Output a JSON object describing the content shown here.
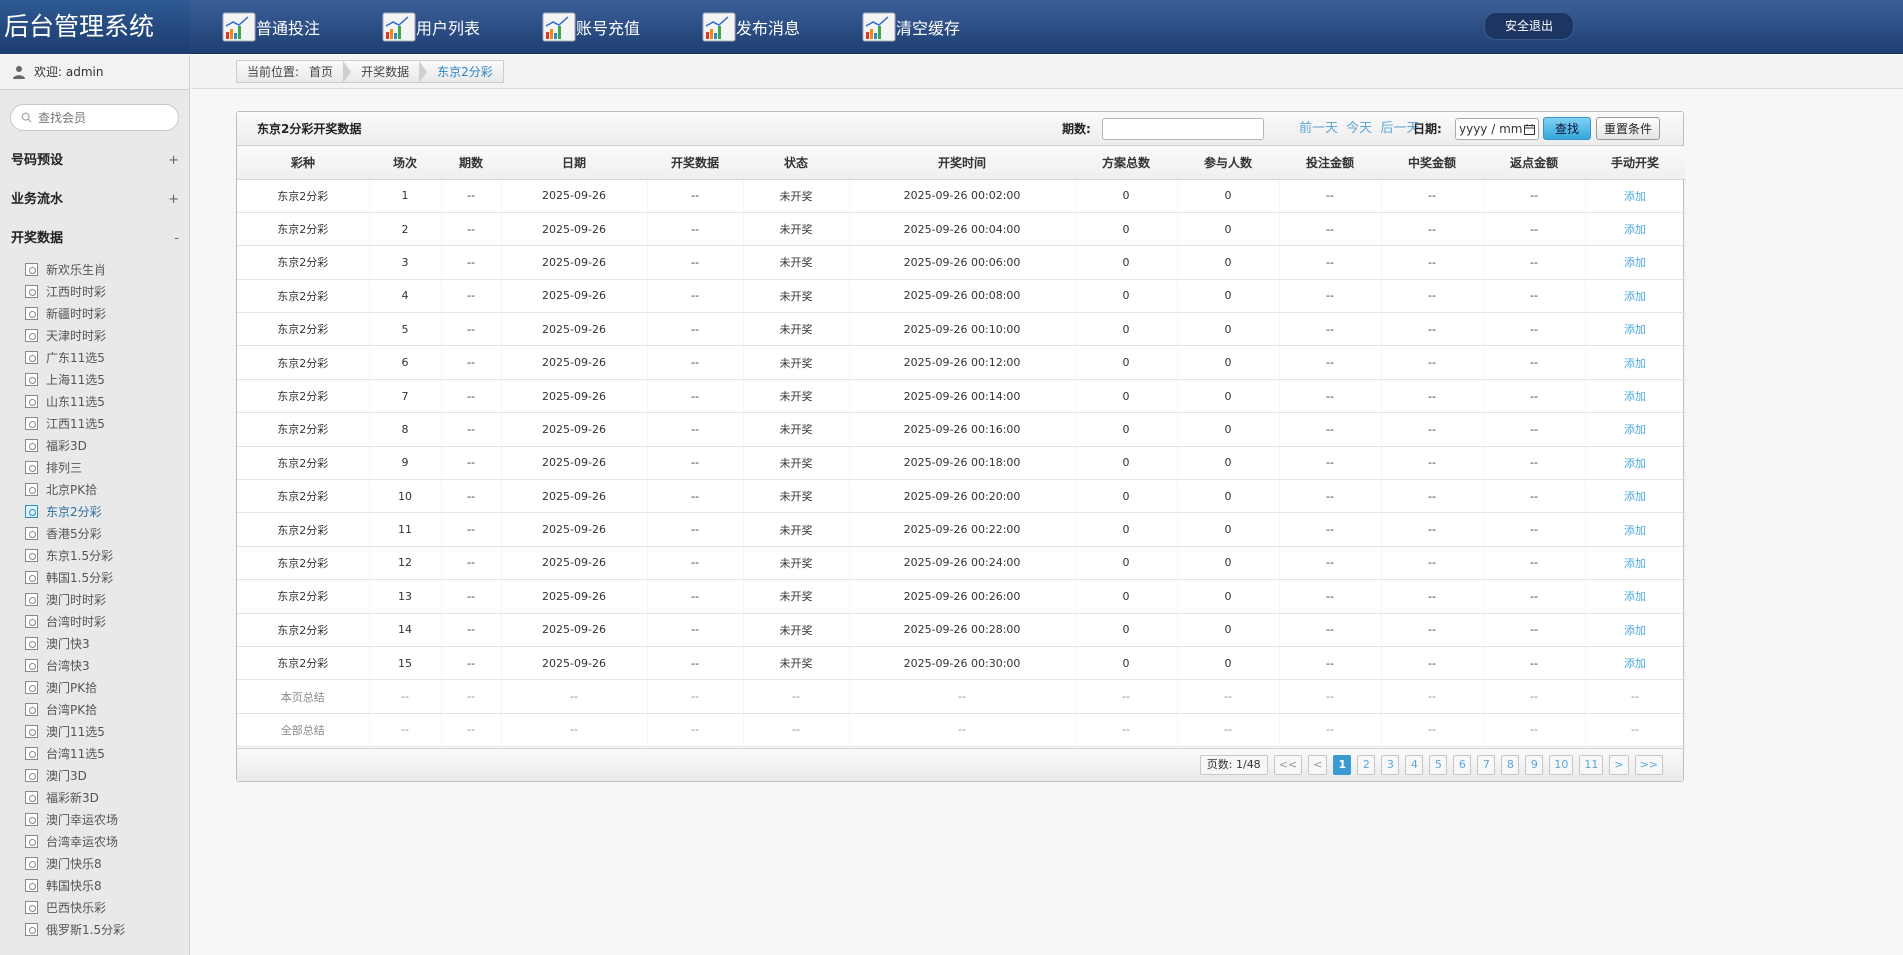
{
  "app": {
    "title": "后台管理系统"
  },
  "topnav": [
    {
      "label": "普通投注"
    },
    {
      "label": "用户列表"
    },
    {
      "label": "账号充值"
    },
    {
      "label": "发布消息"
    },
    {
      "label": "清空缓存"
    }
  ],
  "logout_label": "安全退出",
  "sidebar": {
    "welcome": "欢迎: admin",
    "search_placeholder": "查找会员",
    "groups": [
      {
        "label": "号码预设",
        "sign": "+"
      },
      {
        "label": "业务流水",
        "sign": "+"
      },
      {
        "label": "开奖数据",
        "sign": "-"
      }
    ],
    "items": [
      "新欢乐生肖",
      "江西时时彩",
      "新疆时时彩",
      "天津时时彩",
      "广东11选5",
      "上海11选5",
      "山东11选5",
      "江西11选5",
      "福彩3D",
      "排列三",
      "北京PK拾",
      "东京2分彩",
      "香港5分彩",
      "东京1.5分彩",
      "韩国1.5分彩",
      "澳门时时彩",
      "台湾时时彩",
      "澳门快3",
      "台湾快3",
      "澳门PK拾",
      "台湾PK拾",
      "澳门11选5",
      "台湾11选5",
      "澳门3D",
      "福彩新3D",
      "澳门幸运农场",
      "台湾幸运农场",
      "澳门快乐8",
      "韩国快乐8",
      "巴西快乐彩",
      "俄罗斯1.5分彩"
    ],
    "active_item": "东京2分彩"
  },
  "breadcrumb": {
    "prefix": "当前位置:",
    "home": "首页",
    "section": "开奖数据",
    "current": "东京2分彩"
  },
  "panel": {
    "title": "东京2分彩开奖数据",
    "issue_label": "期数:",
    "prev_day": "前一天",
    "today": "今天",
    "next_day": "后一天",
    "date_label": "日期:",
    "date_placeholder": "yyyy / mm",
    "search_label": "查找",
    "reset_label": "重置条件"
  },
  "table": {
    "columns": [
      "彩种",
      "场次",
      "期数",
      "日期",
      "开奖数据",
      "状态",
      "开奖时间",
      "方案总数",
      "参与人数",
      "投注金额",
      "中奖金额",
      "返点金额",
      "手动开奖"
    ],
    "rows": [
      [
        "东京2分彩",
        "1",
        "--",
        "2025-09-26",
        "--",
        "未开奖",
        "2025-09-26 00:02:00",
        "0",
        "0",
        "--",
        "--",
        "--",
        "添加"
      ],
      [
        "东京2分彩",
        "2",
        "--",
        "2025-09-26",
        "--",
        "未开奖",
        "2025-09-26 00:04:00",
        "0",
        "0",
        "--",
        "--",
        "--",
        "添加"
      ],
      [
        "东京2分彩",
        "3",
        "--",
        "2025-09-26",
        "--",
        "未开奖",
        "2025-09-26 00:06:00",
        "0",
        "0",
        "--",
        "--",
        "--",
        "添加"
      ],
      [
        "东京2分彩",
        "4",
        "--",
        "2025-09-26",
        "--",
        "未开奖",
        "2025-09-26 00:08:00",
        "0",
        "0",
        "--",
        "--",
        "--",
        "添加"
      ],
      [
        "东京2分彩",
        "5",
        "--",
        "2025-09-26",
        "--",
        "未开奖",
        "2025-09-26 00:10:00",
        "0",
        "0",
        "--",
        "--",
        "--",
        "添加"
      ],
      [
        "东京2分彩",
        "6",
        "--",
        "2025-09-26",
        "--",
        "未开奖",
        "2025-09-26 00:12:00",
        "0",
        "0",
        "--",
        "--",
        "--",
        "添加"
      ],
      [
        "东京2分彩",
        "7",
        "--",
        "2025-09-26",
        "--",
        "未开奖",
        "2025-09-26 00:14:00",
        "0",
        "0",
        "--",
        "--",
        "--",
        "添加"
      ],
      [
        "东京2分彩",
        "8",
        "--",
        "2025-09-26",
        "--",
        "未开奖",
        "2025-09-26 00:16:00",
        "0",
        "0",
        "--",
        "--",
        "--",
        "添加"
      ],
      [
        "东京2分彩",
        "9",
        "--",
        "2025-09-26",
        "--",
        "未开奖",
        "2025-09-26 00:18:00",
        "0",
        "0",
        "--",
        "--",
        "--",
        "添加"
      ],
      [
        "东京2分彩",
        "10",
        "--",
        "2025-09-26",
        "--",
        "未开奖",
        "2025-09-26 00:20:00",
        "0",
        "0",
        "--",
        "--",
        "--",
        "添加"
      ],
      [
        "东京2分彩",
        "11",
        "--",
        "2025-09-26",
        "--",
        "未开奖",
        "2025-09-26 00:22:00",
        "0",
        "0",
        "--",
        "--",
        "--",
        "添加"
      ],
      [
        "东京2分彩",
        "12",
        "--",
        "2025-09-26",
        "--",
        "未开奖",
        "2025-09-26 00:24:00",
        "0",
        "0",
        "--",
        "--",
        "--",
        "添加"
      ],
      [
        "东京2分彩",
        "13",
        "--",
        "2025-09-26",
        "--",
        "未开奖",
        "2025-09-26 00:26:00",
        "0",
        "0",
        "--",
        "--",
        "--",
        "添加"
      ],
      [
        "东京2分彩",
        "14",
        "--",
        "2025-09-26",
        "--",
        "未开奖",
        "2025-09-26 00:28:00",
        "0",
        "0",
        "--",
        "--",
        "--",
        "添加"
      ],
      [
        "东京2分彩",
        "15",
        "--",
        "2025-09-26",
        "--",
        "未开奖",
        "2025-09-26 00:30:00",
        "0",
        "0",
        "--",
        "--",
        "--",
        "添加"
      ]
    ],
    "summary_rows": [
      [
        "本页总结",
        "--",
        "--",
        "--",
        "--",
        "--",
        "--",
        "--",
        "--",
        "--",
        "--",
        "--",
        "--"
      ],
      [
        "全部总结",
        "--",
        "--",
        "--",
        "--",
        "--",
        "--",
        "--",
        "--",
        "--",
        "--",
        "--",
        "--"
      ]
    ]
  },
  "pager": {
    "info": "页数: 1/48",
    "first": "<<",
    "prev": "<",
    "pages": [
      "1",
      "2",
      "3",
      "4",
      "5",
      "6",
      "7",
      "8",
      "9",
      "10",
      "11"
    ],
    "current": "1",
    "next": ">",
    "last": ">>"
  },
  "colors": {
    "header": "#2b4f86",
    "accent": "#3a9bd3",
    "link": "#4aa7dc"
  }
}
